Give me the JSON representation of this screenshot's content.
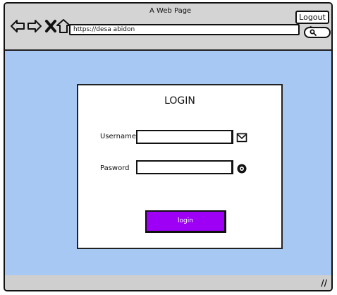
{
  "window": {
    "title": "A Web Page",
    "url": "https://desa abidon",
    "logout_label": "Logout >"
  },
  "icons": {
    "back": "arrow-left-icon",
    "forward": "arrow-right-icon",
    "close": "x-icon",
    "home": "home-icon",
    "search": "search-icon",
    "email": "envelope-icon",
    "password": "eye-icon",
    "resize": "resize-grip-icon"
  },
  "login": {
    "title": "LOGIN",
    "username_label": "Username",
    "password_label": "Pasword",
    "username_value": "",
    "password_value": "",
    "button_label": "login"
  },
  "colors": {
    "content_bg": "#a8c8f4",
    "button_bg": "#9e00f5"
  }
}
